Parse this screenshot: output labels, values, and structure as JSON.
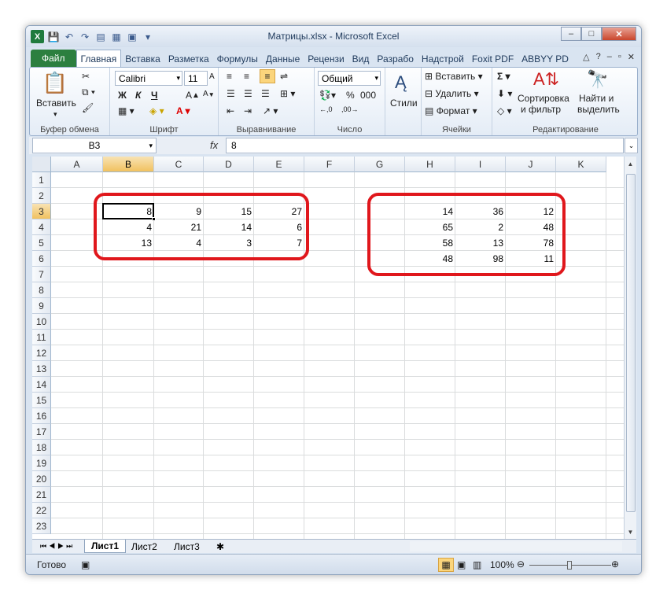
{
  "window": {
    "title": "Матрицы.xlsx - Microsoft Excel"
  },
  "ribbon_tabs": [
    "Файл",
    "Главная",
    "Вставка",
    "Разметка",
    "Формулы",
    "Данные",
    "Рецензи",
    "Вид",
    "Разрабо",
    "Надстрой",
    "Foxit PDF",
    "ABBYY PD"
  ],
  "ribbon": {
    "clipboard": {
      "paste": "Вставить",
      "label": "Буфер обмена"
    },
    "font": {
      "name": "Calibri",
      "size": "11",
      "bold": "Ж",
      "italic": "К",
      "underline": "Ч",
      "label": "Шрифт"
    },
    "alignment": {
      "label": "Выравнивание"
    },
    "number": {
      "format": "Общий",
      "percent": "%",
      "thousands": "000",
      "label": "Число"
    },
    "styles": {
      "label": "Стили"
    },
    "cells": {
      "insert": "Вставить",
      "delete": "Удалить",
      "format": "Формат",
      "label": "Ячейки"
    },
    "editing": {
      "sort": "Сортировка",
      "sort2": "и фильтр",
      "find": "Найти и",
      "find2": "выделить",
      "label": "Редактирование"
    }
  },
  "formula_bar": {
    "name_box": "B3",
    "fx": "fx",
    "value": "8"
  },
  "columns": [
    "A",
    "B",
    "C",
    "D",
    "E",
    "F",
    "G",
    "H",
    "I",
    "J",
    "K"
  ],
  "rows": [
    "1",
    "2",
    "3",
    "4",
    "5",
    "6",
    "7",
    "8",
    "9",
    "10",
    "11",
    "12",
    "13",
    "14",
    "15",
    "16",
    "17",
    "18",
    "19",
    "20",
    "21",
    "22",
    "23"
  ],
  "matrix1": [
    [
      "8",
      "9",
      "15",
      "27"
    ],
    [
      "4",
      "21",
      "14",
      "6"
    ],
    [
      "13",
      "4",
      "3",
      "7"
    ]
  ],
  "matrix2": [
    [
      "14",
      "36",
      "12"
    ],
    [
      "65",
      "2",
      "48"
    ],
    [
      "58",
      "13",
      "78"
    ],
    [
      "48",
      "98",
      "11"
    ]
  ],
  "sheets": [
    "Лист1",
    "Лист2",
    "Лист3"
  ],
  "status": {
    "ready": "Готово",
    "zoom": "100%"
  },
  "colors": {
    "highlight": "#e0171c",
    "file_tab": "#2c7f3f",
    "selected_header": "#f1c15f"
  }
}
